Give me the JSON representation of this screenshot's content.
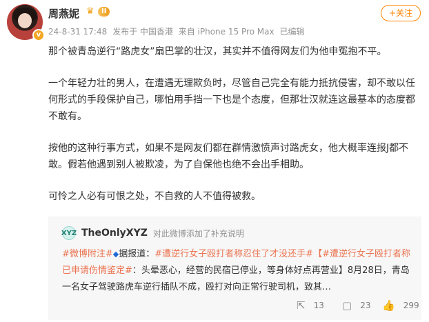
{
  "post": {
    "username": "周燕妮",
    "level_badge": "II",
    "verified_mark": "v",
    "follow_label": "+关注",
    "meta": {
      "date": "24-8-31 17:48",
      "location": "发布于 中国香港",
      "device": "来自 iPhone 15 Pro Max",
      "edited": "已编辑"
    },
    "paragraphs": [
      "那个被青岛逆行“路虎女”扇巴掌的壮汉，其实并不值得网友们为他申冤抱不平。",
      "一个年轻力壮的男人，在遭遇无理欺负时，尽管自己完全有能力抵抗侵害，却不敢以任何形式的手段保护自己，哪怕用手挡一下也是个态度，但那壮汉就连这最基本的态度都不敢有。",
      "按他的这种行事方式，如果不是网友们都在群情激愤声讨路虎女，他大概率连报J都不敢。假若他遇到别人被欺凌，为了自保他也绝不会出手相助。",
      "可怜之人必有可恨之处，不自救的人不值得被救。"
    ]
  },
  "quote": {
    "avatar_text": "XYZ",
    "author": "TheOnlyXYZ",
    "note": "对此微博添加了补充说明",
    "tag1": "#微博附注#",
    "source_icon": "◆",
    "source_label": "据报道：",
    "tag2": "#遭逆行女子殴打者称忍住了才没还手#",
    "tag3": "【#遭逆行女子殴打者称已申请伤情鉴定#",
    "text1": "：头晕恶心，经营的民宿已停业，等身体好点再营业】8月28日，青岛一名女子驾驶路虎车逆行插队不成，殴打对向正常行驶司机，致其…"
  },
  "actions": {
    "share_count": "13",
    "comment_count": "23",
    "like_count": "299"
  }
}
